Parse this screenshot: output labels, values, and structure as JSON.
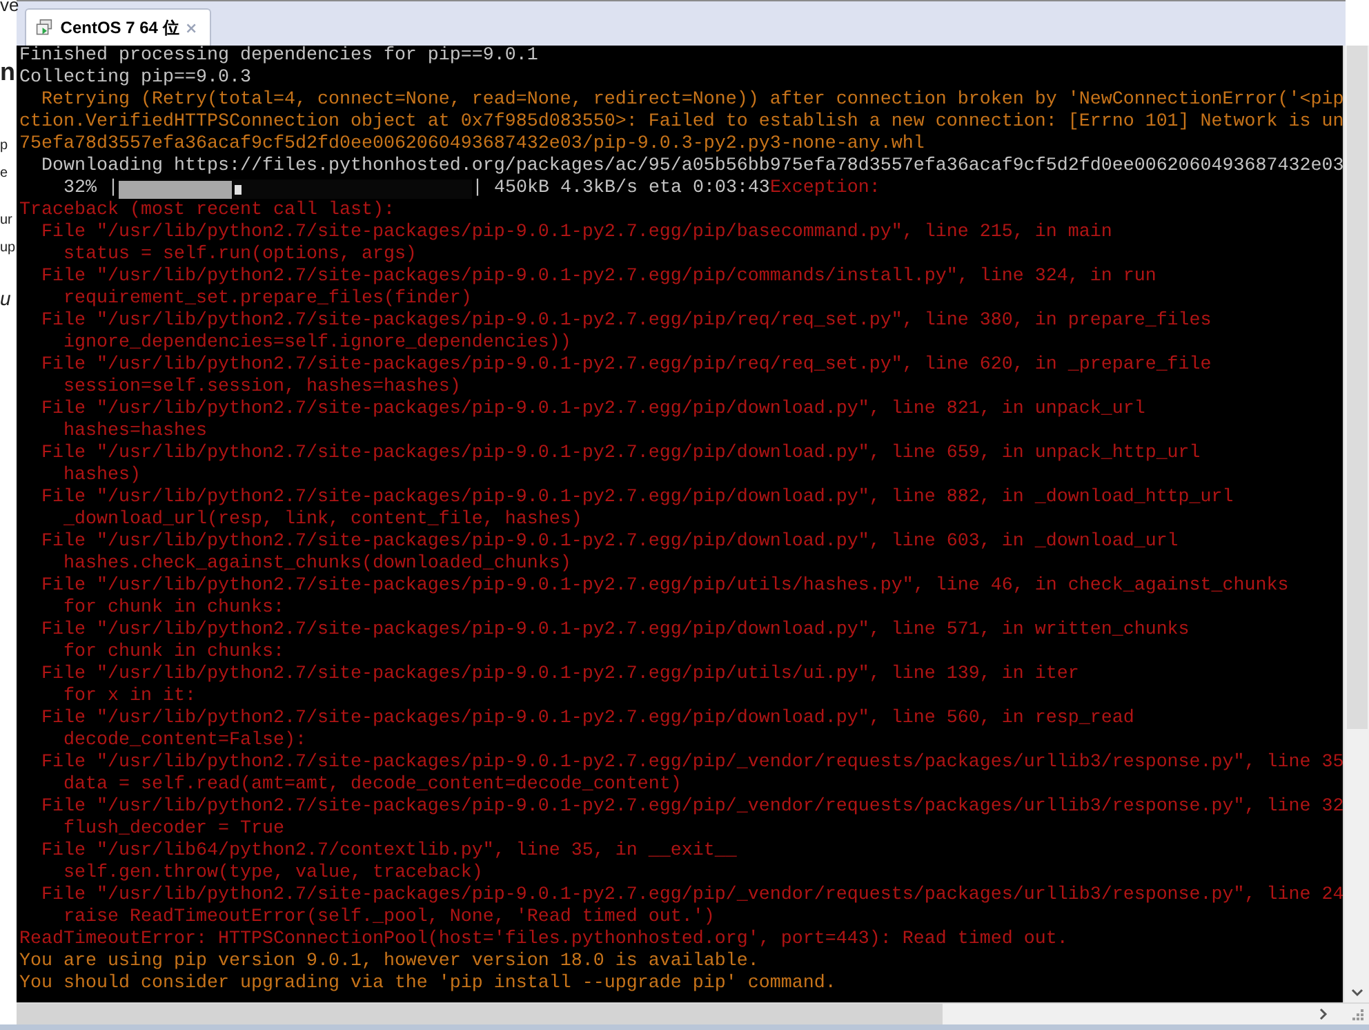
{
  "background_page": {
    "fragments": [
      {
        "text": "ve",
        "kind": "small"
      },
      {
        "text": "n",
        "kind": "heading"
      },
      {
        "text": "p",
        "kind": "body"
      },
      {
        "text": "e",
        "kind": "body"
      },
      {
        "text": "ur",
        "kind": "body"
      },
      {
        "text": "up",
        "kind": "body"
      },
      {
        "text": "u",
        "kind": "italic"
      }
    ]
  },
  "tabs": [
    {
      "label": "CentOS 7 64 位",
      "selected": true
    }
  ],
  "console": {
    "lines": [
      {
        "kind": "text",
        "segments": [
          {
            "text": "Finished processing dependencies for pip==9.0.1",
            "color": "#c4c4c4"
          }
        ]
      },
      {
        "kind": "text",
        "segments": [
          {
            "text": "Collecting pip==9.0.3",
            "color": "#c4c4c4"
          }
        ]
      },
      {
        "kind": "text",
        "segments": [
          {
            "text": "  Retrying (Retry(total=4, connect=None, read=None, redirect=None)) after connection broken by 'NewConnectionError('<pip",
            "color": "#c8741a"
          }
        ]
      },
      {
        "kind": "text",
        "segments": [
          {
            "text": "ction.VerifiedHTTPSConnection object at 0x7f985d083550>: Failed to establish a new connection: [Errno 101] Network is un",
            "color": "#c8741a"
          }
        ]
      },
      {
        "kind": "text",
        "segments": [
          {
            "text": "75efa78d3557efa36acaf9cf5d2fd0ee0062060493687432e03/pip-9.0.3-py2.py3-none-any.whl",
            "color": "#c8741a"
          }
        ]
      },
      {
        "kind": "text",
        "segments": [
          {
            "text": "  Downloading https://files.pythonhosted.org/packages/ac/95/a05b56bb975efa78d3557efa36acaf9cf5d2fd0ee0062060493687432e03",
            "color": "#c4c4c4"
          }
        ]
      },
      {
        "kind": "progress",
        "prefix": {
          "text": "    32% |",
          "color": "#c4c4c4"
        },
        "level": 0.32,
        "segments": [
          {
            "text": "| 450kB 4.3kB/s eta 0:03:43",
            "color": "#c4c4c4"
          },
          {
            "text": "Exception:",
            "color": "#b01414"
          }
        ]
      },
      {
        "kind": "text",
        "segments": [
          {
            "text": "Traceback (most recent call last):",
            "color": "#b01414"
          }
        ]
      },
      {
        "kind": "text",
        "segments": [
          {
            "text": "  File \"/usr/lib/python2.7/site-packages/pip-9.0.1-py2.7.egg/pip/basecommand.py\", line 215, in main",
            "color": "#b01414"
          }
        ]
      },
      {
        "kind": "text",
        "segments": [
          {
            "text": "    status = self.run(options, args)",
            "color": "#b01414"
          }
        ]
      },
      {
        "kind": "text",
        "segments": [
          {
            "text": "  File \"/usr/lib/python2.7/site-packages/pip-9.0.1-py2.7.egg/pip/commands/install.py\", line 324, in run",
            "color": "#b01414"
          }
        ]
      },
      {
        "kind": "text",
        "segments": [
          {
            "text": "    requirement_set.prepare_files(finder)",
            "color": "#b01414"
          }
        ]
      },
      {
        "kind": "text",
        "segments": [
          {
            "text": "  File \"/usr/lib/python2.7/site-packages/pip-9.0.1-py2.7.egg/pip/req/req_set.py\", line 380, in prepare_files",
            "color": "#b01414"
          }
        ]
      },
      {
        "kind": "text",
        "segments": [
          {
            "text": "    ignore_dependencies=self.ignore_dependencies))",
            "color": "#b01414"
          }
        ]
      },
      {
        "kind": "text",
        "segments": [
          {
            "text": "  File \"/usr/lib/python2.7/site-packages/pip-9.0.1-py2.7.egg/pip/req/req_set.py\", line 620, in _prepare_file",
            "color": "#b01414"
          }
        ]
      },
      {
        "kind": "text",
        "segments": [
          {
            "text": "    session=self.session, hashes=hashes)",
            "color": "#b01414"
          }
        ]
      },
      {
        "kind": "text",
        "segments": [
          {
            "text": "  File \"/usr/lib/python2.7/site-packages/pip-9.0.1-py2.7.egg/pip/download.py\", line 821, in unpack_url",
            "color": "#b01414"
          }
        ]
      },
      {
        "kind": "text",
        "segments": [
          {
            "text": "    hashes=hashes",
            "color": "#b01414"
          }
        ]
      },
      {
        "kind": "text",
        "segments": [
          {
            "text": "  File \"/usr/lib/python2.7/site-packages/pip-9.0.1-py2.7.egg/pip/download.py\", line 659, in unpack_http_url",
            "color": "#b01414"
          }
        ]
      },
      {
        "kind": "text",
        "segments": [
          {
            "text": "    hashes)",
            "color": "#b01414"
          }
        ]
      },
      {
        "kind": "text",
        "segments": [
          {
            "text": "  File \"/usr/lib/python2.7/site-packages/pip-9.0.1-py2.7.egg/pip/download.py\", line 882, in _download_http_url",
            "color": "#b01414"
          }
        ]
      },
      {
        "kind": "text",
        "segments": [
          {
            "text": "    _download_url(resp, link, content_file, hashes)",
            "color": "#b01414"
          }
        ]
      },
      {
        "kind": "text",
        "segments": [
          {
            "text": "  File \"/usr/lib/python2.7/site-packages/pip-9.0.1-py2.7.egg/pip/download.py\", line 603, in _download_url",
            "color": "#b01414"
          }
        ]
      },
      {
        "kind": "text",
        "segments": [
          {
            "text": "    hashes.check_against_chunks(downloaded_chunks)",
            "color": "#b01414"
          }
        ]
      },
      {
        "kind": "text",
        "segments": [
          {
            "text": "  File \"/usr/lib/python2.7/site-packages/pip-9.0.1-py2.7.egg/pip/utils/hashes.py\", line 46, in check_against_chunks",
            "color": "#b01414"
          }
        ]
      },
      {
        "kind": "text",
        "segments": [
          {
            "text": "    for chunk in chunks:",
            "color": "#b01414"
          }
        ]
      },
      {
        "kind": "text",
        "segments": [
          {
            "text": "  File \"/usr/lib/python2.7/site-packages/pip-9.0.1-py2.7.egg/pip/download.py\", line 571, in written_chunks",
            "color": "#b01414"
          }
        ]
      },
      {
        "kind": "text",
        "segments": [
          {
            "text": "    for chunk in chunks:",
            "color": "#b01414"
          }
        ]
      },
      {
        "kind": "text",
        "segments": [
          {
            "text": "  File \"/usr/lib/python2.7/site-packages/pip-9.0.1-py2.7.egg/pip/utils/ui.py\", line 139, in iter",
            "color": "#b01414"
          }
        ]
      },
      {
        "kind": "text",
        "segments": [
          {
            "text": "    for x in it:",
            "color": "#b01414"
          }
        ]
      },
      {
        "kind": "text",
        "segments": [
          {
            "text": "  File \"/usr/lib/python2.7/site-packages/pip-9.0.1-py2.7.egg/pip/download.py\", line 560, in resp_read",
            "color": "#b01414"
          }
        ]
      },
      {
        "kind": "text",
        "segments": [
          {
            "text": "    decode_content=False):",
            "color": "#b01414"
          }
        ]
      },
      {
        "kind": "text",
        "segments": [
          {
            "text": "  File \"/usr/lib/python2.7/site-packages/pip-9.0.1-py2.7.egg/pip/_vendor/requests/packages/urllib3/response.py\", line 35",
            "color": "#b01414"
          }
        ]
      },
      {
        "kind": "text",
        "segments": [
          {
            "text": "    data = self.read(amt=amt, decode_content=decode_content)",
            "color": "#b01414"
          }
        ]
      },
      {
        "kind": "text",
        "segments": [
          {
            "text": "  File \"/usr/lib/python2.7/site-packages/pip-9.0.1-py2.7.egg/pip/_vendor/requests/packages/urllib3/response.py\", line 32",
            "color": "#b01414"
          }
        ]
      },
      {
        "kind": "text",
        "segments": [
          {
            "text": "    flush_decoder = True",
            "color": "#b01414"
          }
        ]
      },
      {
        "kind": "text",
        "segments": [
          {
            "text": "  File \"/usr/lib64/python2.7/contextlib.py\", line 35, in __exit__",
            "color": "#b01414"
          }
        ]
      },
      {
        "kind": "text",
        "segments": [
          {
            "text": "    self.gen.throw(type, value, traceback)",
            "color": "#b01414"
          }
        ]
      },
      {
        "kind": "text",
        "segments": [
          {
            "text": "  File \"/usr/lib/python2.7/site-packages/pip-9.0.1-py2.7.egg/pip/_vendor/requests/packages/urllib3/response.py\", line 24",
            "color": "#b01414"
          }
        ]
      },
      {
        "kind": "text",
        "segments": [
          {
            "text": "    raise ReadTimeoutError(self._pool, None, 'Read timed out.')",
            "color": "#b01414"
          }
        ]
      },
      {
        "kind": "text",
        "segments": [
          {
            "text": "ReadTimeoutError: HTTPSConnectionPool(host='files.pythonhosted.org', port=443): Read timed out.",
            "color": "#b01414"
          }
        ]
      },
      {
        "kind": "text",
        "segments": [
          {
            "text": "You are using pip version 9.0.1, however version 18.0 is available.",
            "color": "#c8741a"
          }
        ]
      },
      {
        "kind": "text",
        "segments": [
          {
            "text": "You should consider upgrading via the 'pip install --upgrade pip' command.",
            "color": "#c8741a"
          }
        ]
      }
    ]
  }
}
